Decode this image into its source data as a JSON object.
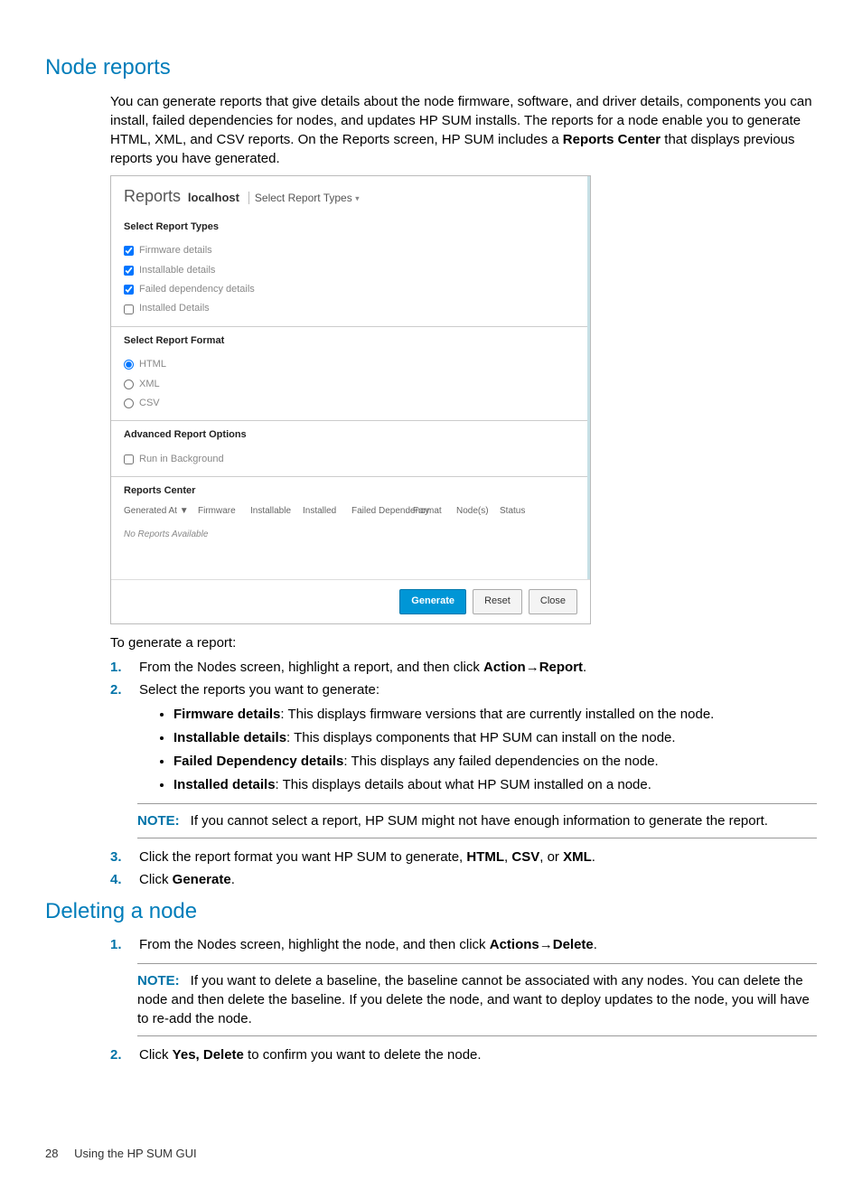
{
  "section1": {
    "title": "Node reports",
    "intro": "You can generate reports that give details about the node firmware, software, and driver details, components you can install, failed dependencies for nodes, and updates HP SUM installs. The reports for a node enable you to generate HTML, XML, and CSV reports. On the Reports screen, HP SUM includes a ",
    "intro_bold": "Reports Center",
    "intro_tail": " that displays previous reports you have generated."
  },
  "scr": {
    "brand": "Reports",
    "host": "localhost",
    "dropdown": "Select Report Types",
    "types_title": "Select Report Types",
    "types": [
      "Firmware details",
      "Installable details",
      "Failed dependency details",
      "Installed Details"
    ],
    "format_title": "Select Report Format",
    "formats": [
      "HTML",
      "XML",
      "CSV"
    ],
    "adv_title": "Advanced Report Options",
    "adv_opt": "Run in Background",
    "center_title": "Reports Center",
    "cols": [
      "Generated At ▼",
      "Firmware",
      "Installable",
      "Installed",
      "Failed Dependency",
      "Format",
      "Node(s)",
      "Status"
    ],
    "none": "No Reports Available",
    "btn_generate": "Generate",
    "btn_reset": "Reset",
    "btn_close": "Close"
  },
  "gen": {
    "lead": "To generate a report:",
    "s1a": "From the Nodes screen, highlight a report, and then click ",
    "s1b": "Action",
    "s1c": "Report",
    "s2": "Select the reports you want to generate:",
    "b1a": "Firmware details",
    "b1b": ": This displays firmware versions that are currently installed on the node.",
    "b2a": "Installable details",
    "b2b": ": This displays components that HP SUM can install on the node.",
    "b3a": "Failed Dependency details",
    "b3b": ": This displays any failed dependencies on the node.",
    "b4a": "Installed details",
    "b4b": ": This displays details about what HP SUM installed on a node.",
    "note1_label": "NOTE:",
    "note1": "If you cannot select a report, HP SUM might not have enough information to generate the report.",
    "s3a": "Click the report format you want HP SUM to generate, ",
    "s3b": "HTML",
    "s3c": "CSV",
    "s3d": "XML",
    "s4a": "Click ",
    "s4b": "Generate"
  },
  "del": {
    "title": "Deleting a node",
    "s1a": "From the Nodes screen, highlight the node, and then click ",
    "s1b": "Actions",
    "s1c": "Delete",
    "note_label": "NOTE:",
    "note": "If you want to delete a baseline, the baseline cannot be associated with any nodes. You can delete the node and then delete the baseline. If you delete the node, and want to deploy updates to the node, you will have to re-add the node.",
    "s2a": "Click ",
    "s2b": "Yes, Delete",
    "s2c": " to confirm you want to delete the node."
  },
  "footer": {
    "page": "28",
    "title": "Using the HP SUM GUI"
  }
}
